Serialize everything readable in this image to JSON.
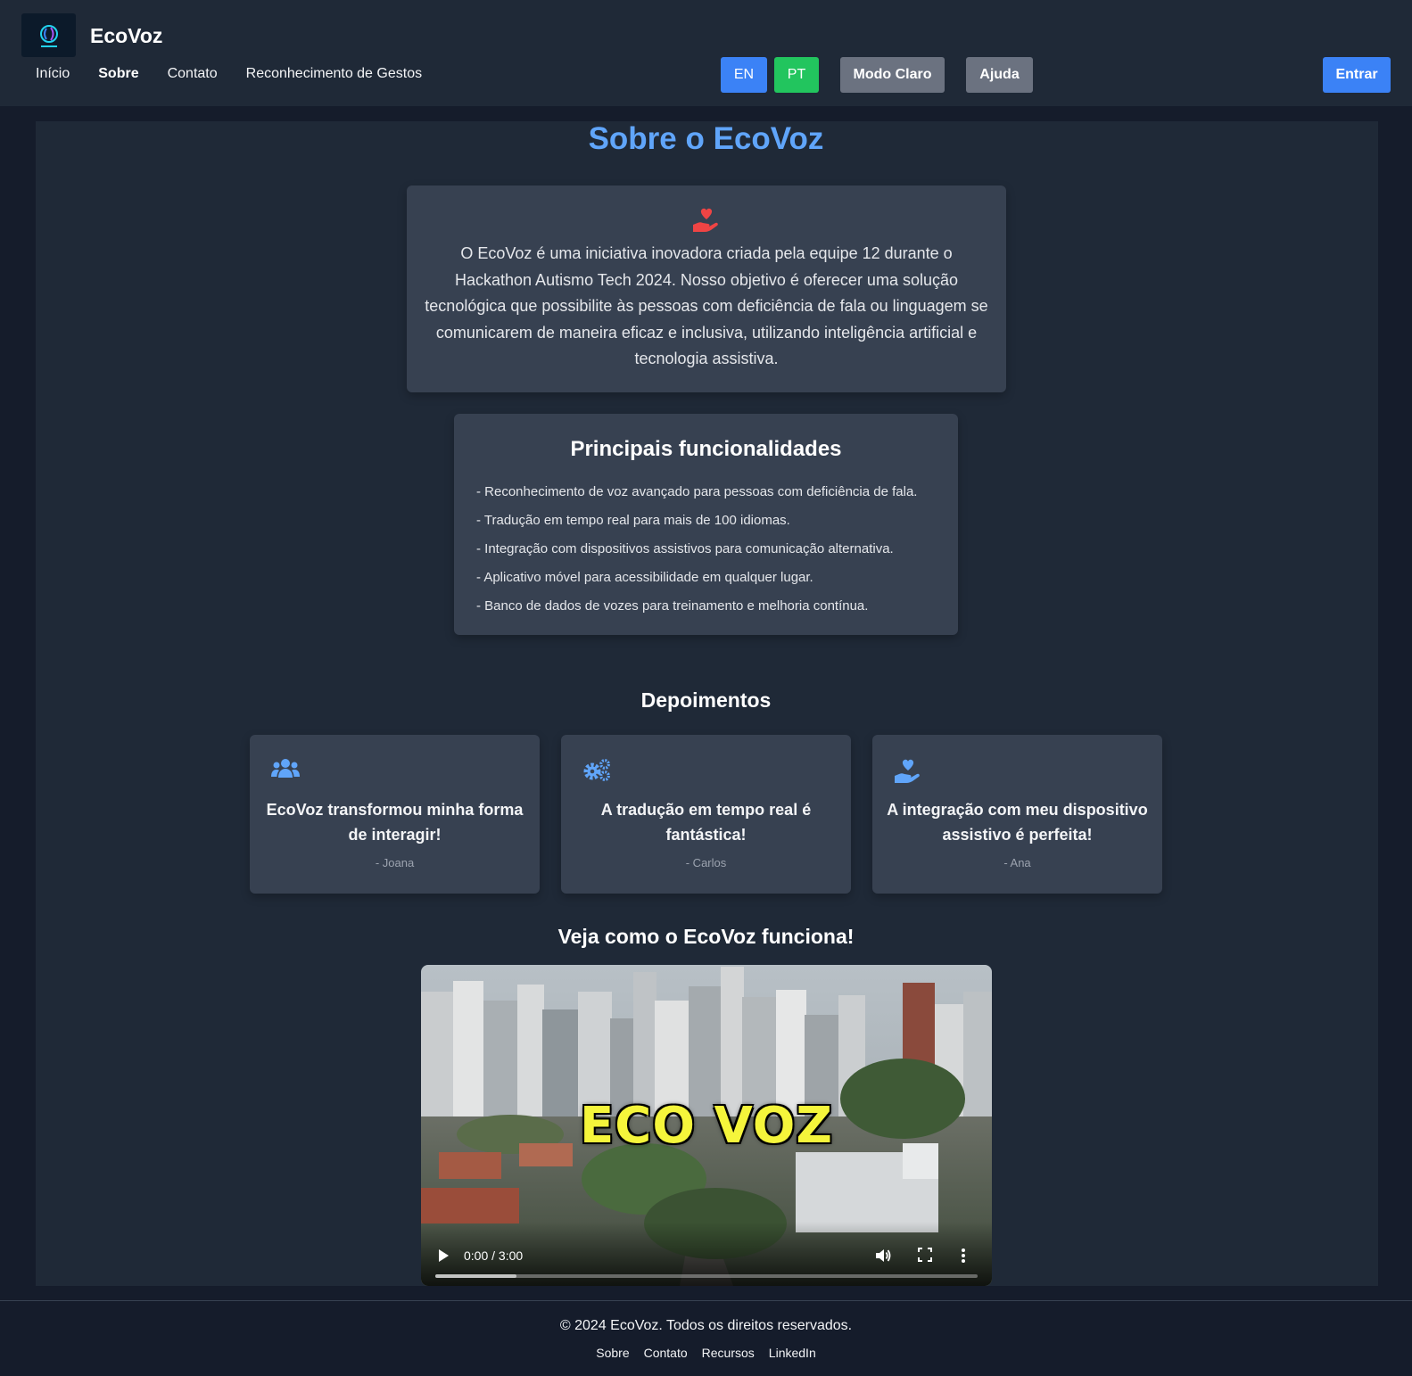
{
  "header": {
    "brand": "EcoVoz",
    "nav": [
      "Início",
      "Sobre",
      "Contato",
      "Reconhecimento de Gestos"
    ],
    "lang_en": "EN",
    "lang_pt": "PT",
    "theme_button": "Modo Claro",
    "help_button": "Ajuda",
    "login_button": "Entrar"
  },
  "about": {
    "title": "Sobre o EcoVoz",
    "text": "O EcoVoz é uma iniciativa inovadora criada pela equipe 12 durante o Hackathon Autismo Tech 2024. Nosso objetivo é oferecer uma solução tecnológica que possibilite às pessoas com deficiência de fala ou linguagem se comunicarem de maneira eficaz e inclusiva, utilizando inteligência artificial e tecnologia assistiva."
  },
  "features": {
    "title": "Principais funcionalidades",
    "items": [
      "- Reconhecimento de voz avançado para pessoas com deficiência de fala.",
      "- Tradução em tempo real para mais de 100 idiomas.",
      "- Integração com dispositivos assistivos para comunicação alternativa.",
      "- Aplicativo móvel para acessibilidade em qualquer lugar.",
      "- Banco de dados de vozes para treinamento e melhoria contínua."
    ]
  },
  "testimonials": {
    "title": "Depoimentos",
    "items": [
      {
        "icon": "users-icon",
        "quote": "EcoVoz transformou minha forma de interagir!",
        "author": "- Joana"
      },
      {
        "icon": "cogs-icon",
        "quote": "A tradução em tempo real é fantástica!",
        "author": "- Carlos"
      },
      {
        "icon": "hand-holding-heart-icon",
        "quote": "A integração com meu dispositivo assistivo é perfeita!",
        "author": "- Ana"
      }
    ]
  },
  "video": {
    "title": "Veja como o EcoVoz funciona!",
    "overlay_text": "ECO VOZ",
    "time": "0:00 / 3:00",
    "buffered_fraction": 0.15
  },
  "footer": {
    "copyright": "© 2024 EcoVoz. Todos os direitos reservados.",
    "links": [
      "Sobre",
      "Contato",
      "Recursos",
      "LinkedIn"
    ]
  },
  "colors": {
    "accent_blue": "#3b82f6",
    "title_blue": "#60a5fa",
    "pt_green": "#22c55e",
    "heart_red": "#ef4444",
    "icon_blue": "#60a5fa"
  }
}
